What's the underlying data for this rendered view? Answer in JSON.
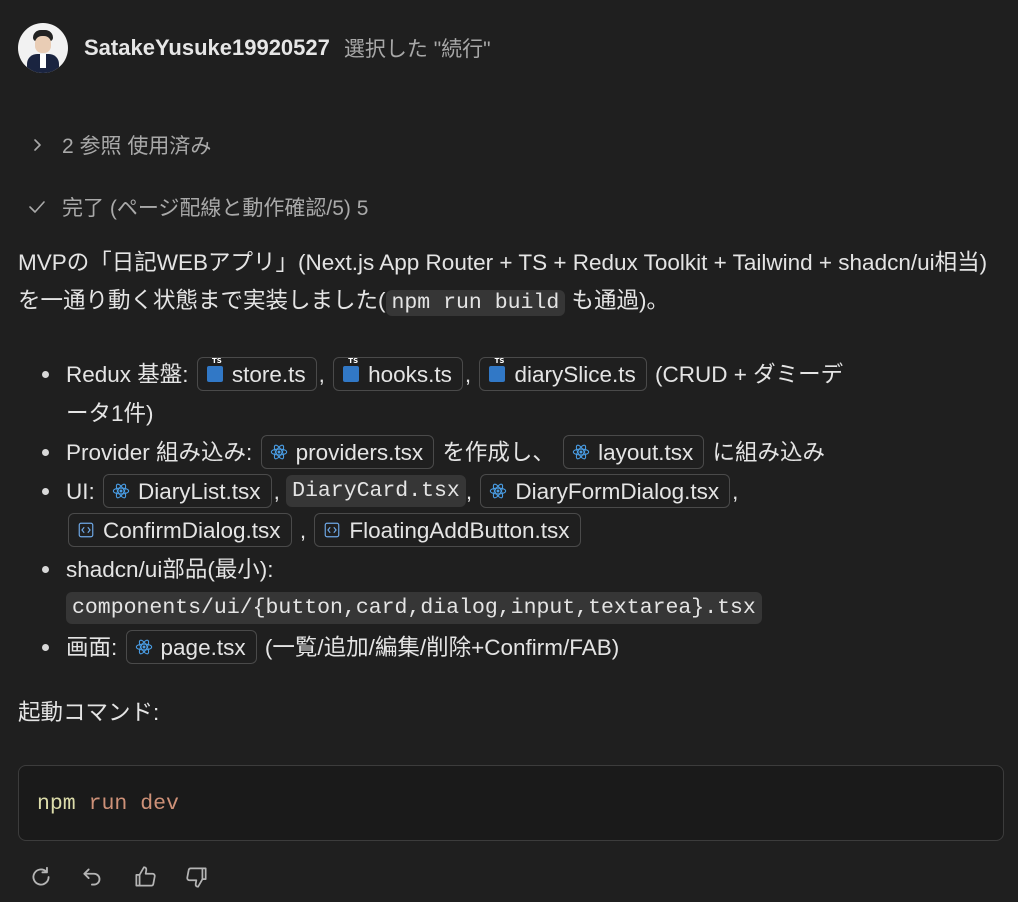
{
  "header": {
    "username": "SatakeYusuke19920527",
    "action": "選択した \"続行\""
  },
  "references": {
    "label": "2 参照 使用済み",
    "icon": "chevron-right-icon"
  },
  "done": {
    "label": "完了 (ページ配線と動作確認/5) 5",
    "icon": "check-icon"
  },
  "intro": {
    "text1": "MVPの「日記WEBアプリ」(Next.js App Router + TS + Redux Toolkit + Tailwind + shadcn/ui相当)を一通り動く状態まで実装しました(",
    "code": "npm run build",
    "text2": "も通過)。"
  },
  "list": {
    "redux": {
      "label": "Redux 基盤:",
      "files": [
        "store.ts",
        "hooks.ts",
        "diarySlice.ts"
      ],
      "sep": ",",
      "note_line1": "(CRUD + ダミーデ",
      "note_line2": "ータ1件)"
    },
    "provider": {
      "label": "Provider 組み込み:",
      "file1": "providers.tsx",
      "mid": "を作成し、",
      "file2": "layout.tsx",
      "tail": "に組み込み"
    },
    "ui": {
      "label": "UI:",
      "file1": "DiaryList.tsx",
      "code": "DiaryCard.tsx",
      "file2": "DiaryFormDialog.tsx",
      "file3": "ConfirmDialog.tsx",
      "file4": "FloatingAddButton.tsx",
      "sep": ","
    },
    "shadcn": {
      "label": "shadcn/ui部品(最小):",
      "code": "components/ui/{button,card,dialog,input,textarea}.tsx"
    },
    "screen": {
      "label": "画面:",
      "file": "page.tsx",
      "note": "(一覧/追加/編集/削除+Confirm/FAB)"
    }
  },
  "start": {
    "label": "起動コマンド:"
  },
  "codeblock": {
    "cmd": "npm",
    "args": "run dev"
  },
  "footer": {
    "icons": [
      "refresh-icon",
      "undo-icon",
      "thumbs-up-icon",
      "thumbs-down-icon"
    ]
  },
  "colors": {
    "background": "#1f1f1f",
    "ts_badge": "#3178c6",
    "react_icon": "#4a9ee6"
  }
}
